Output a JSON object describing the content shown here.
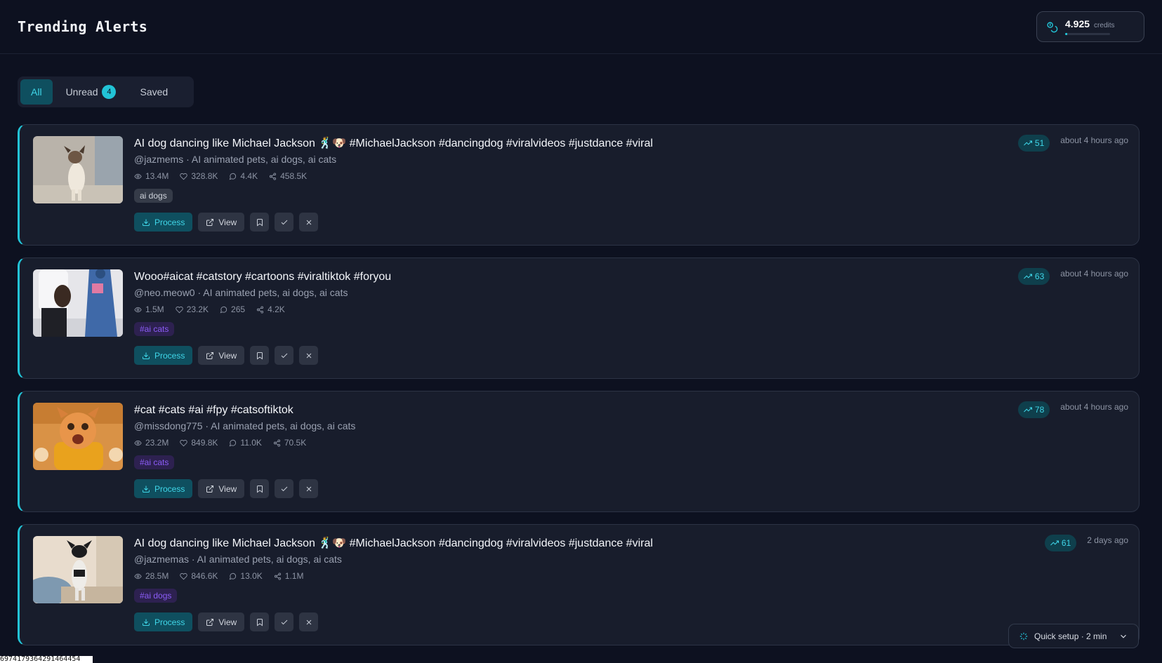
{
  "header": {
    "title": "Trending Alerts"
  },
  "credits": {
    "value": "4.925",
    "unit": "credits",
    "fill_fraction": 0.05
  },
  "tabs": [
    {
      "label": "All",
      "active": true
    },
    {
      "label": "Unread",
      "badge": "4"
    },
    {
      "label": "Saved"
    }
  ],
  "buttons": {
    "process": "Process",
    "view": "View"
  },
  "alerts": [
    {
      "title": "AI dog dancing like Michael Jackson 🕺🐶 #MichaelJackson #dancingdog #viralvideos #justdance #viral",
      "meta": "@jazmems · AI animated pets, ai dogs, ai cats",
      "views": "13.4M",
      "likes": "328.8K",
      "comments": "4.4K",
      "shares": "458.5K",
      "tag": "ai dogs",
      "tag_style": "gray",
      "score": "51",
      "time": "about 4 hours ago"
    },
    {
      "title": "Wooo#aicat #catstory #cartoons #viraltiktok #foryou",
      "meta": "@neo.meow0 · AI animated pets, ai dogs, ai cats",
      "views": "1.5M",
      "likes": "23.2K",
      "comments": "265",
      "shares": "4.2K",
      "tag": "#ai cats",
      "tag_style": "purple",
      "score": "63",
      "time": "about 4 hours ago"
    },
    {
      "title": "#cat #cats #ai #fpy #catsoftiktok",
      "meta": "@missdong775 · AI animated pets, ai dogs, ai cats",
      "views": "23.2M",
      "likes": "849.8K",
      "comments": "11.0K",
      "shares": "70.5K",
      "tag": "#ai cats",
      "tag_style": "purple",
      "score": "78",
      "time": "about 4 hours ago"
    },
    {
      "title": "AI dog dancing like Michael Jackson 🕺🐶 #MichaelJackson #dancingdog #viralvideos #justdance #viral",
      "meta": "@jazmemas · AI animated pets, ai dogs, ai cats",
      "views": "28.5M",
      "likes": "846.6K",
      "comments": "13.0K",
      "shares": "1.1M",
      "tag": "#ai dogs",
      "tag_style": "purple",
      "score": "61",
      "time": "2 days ago"
    }
  ],
  "quick_setup": {
    "label": "Quick setup · 2 min"
  },
  "bottom_peek": {
    "text": "6974179364291464454"
  }
}
